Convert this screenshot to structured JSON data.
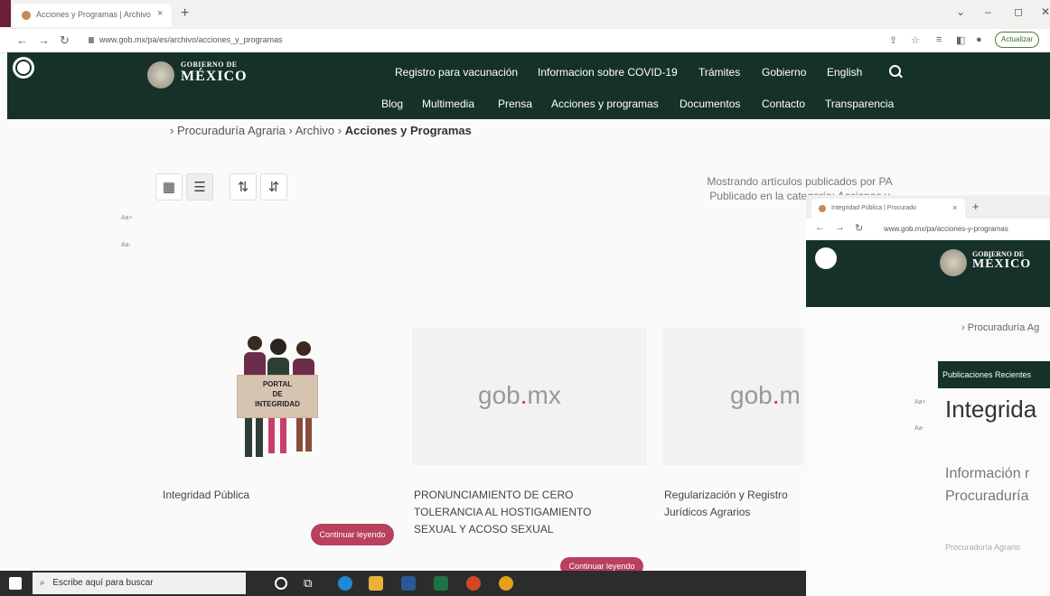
{
  "browser": {
    "tab_title": "Acciones y Programas | Archivo",
    "tab_close": "×",
    "new_tab": "+",
    "url": "www.gob.mx/pa/es/archivo/acciones_y_programas",
    "update_label": "Actualizar"
  },
  "header": {
    "logo_small": "GOBIERNO DE",
    "logo_big": "MÉXICO",
    "nav_top": [
      "Registro para vacunación",
      "Informacion sobre COVID-19",
      "Trámites",
      "Gobierno",
      "English"
    ],
    "nav_bottom": [
      "Blog",
      "Multimedia",
      "Prensa",
      "Acciones y programas",
      "Documentos",
      "Contacto",
      "Transparencia"
    ]
  },
  "breadcrumb": {
    "item1": "Procuraduría Agraria",
    "item2": "Archivo",
    "current": "Acciones y Programas"
  },
  "filter": {
    "line1": "Mostrando artículos publicados por  PA",
    "line2": "Publicado en la categoría: Acciones y"
  },
  "font_toggles": [
    "Aa+",
    "Aa-"
  ],
  "cards": [
    {
      "title": "Integridad Pública",
      "image_text": "",
      "button": "Continuar leyendo"
    },
    {
      "title": "PRONUNCIAMIENTO DE CERO TOLERANCIA AL HOSTIGAMIENTO SEXUAL Y ACOSO SEXUAL",
      "image_text": "gob.mx",
      "button": "Continuar leyendo"
    },
    {
      "title": "Regularización y Registro Jurídicos Agrarios",
      "image_text": "gob.m",
      "button": ""
    }
  ],
  "portal_sign": [
    "PORTAL",
    "DE",
    "INTEGRIDAD"
  ],
  "second_window": {
    "tab_title": "Integridad Pública | Procurado",
    "url": "www.gob.mx/pa/acciones-y-programas",
    "logo_small": "GOBIERNO DE",
    "logo_big": "MÉXICO",
    "breadcrumb": "Procuraduría Ag",
    "recent_label": "Publicaciones Recientes",
    "heading": "Integrida",
    "info_line1": "Información r",
    "info_line2": "Procuraduría",
    "footer_crumb": "Procuraduría Agrario"
  },
  "taskbar": {
    "search_placeholder": "Escribe aquí para buscar"
  },
  "colors": {
    "header": "#16312a",
    "accent": "#b9405f",
    "tab_maroon": "#6b1f3a"
  }
}
